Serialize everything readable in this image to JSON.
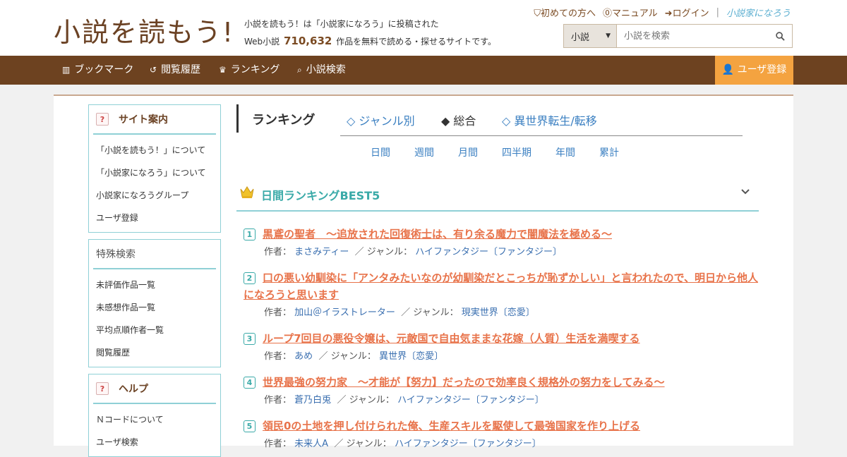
{
  "header": {
    "logo_text": "小説を読もう!",
    "description_line1": "小説を読もう！は「小説家になろう」に投稿された",
    "description_prefix": "Web小説",
    "work_count": "710,632",
    "description_suffix": "作品を無料で読める・探せるサイトです。",
    "top_links": [
      {
        "label": "初めての方へ",
        "icon": "shield-icon"
      },
      {
        "label": "マニュアル",
        "icon": "question-circle-icon"
      },
      {
        "label": "ログイン",
        "icon": "login-icon"
      }
    ],
    "brand_link": "小説家になろう",
    "search": {
      "select_value": "小説",
      "placeholder": "小説を検索"
    }
  },
  "nav": {
    "items": [
      {
        "label": "ブックマーク",
        "icon": "bookmark-icon"
      },
      {
        "label": "閲覧履歴",
        "icon": "history-icon"
      },
      {
        "label": "ランキング",
        "icon": "crown-icon"
      },
      {
        "label": "小説検索",
        "icon": "search-icon"
      }
    ],
    "register": "ユーザ登録"
  },
  "sidebar": {
    "site_info": {
      "title": "サイト案内",
      "items": [
        "「小説を読もう！」について",
        "「小説家になろう」について",
        "小説家になろうグループ",
        "ユーザ登録"
      ]
    },
    "special_search": {
      "title": "特殊検索",
      "items": [
        "未評価作品一覧",
        "未感想作品一覧",
        "平均点順作者一覧",
        "閲覧履歴"
      ]
    },
    "help": {
      "title": "ヘルプ",
      "items": [
        "Ｎコードについて",
        "ユーザ検索"
      ]
    }
  },
  "ranking": {
    "title": "ランキング",
    "tabs": [
      "◇ ジャンル別",
      "◆ 総合",
      "◇ 異世界転生/転移"
    ],
    "periods": [
      "日間",
      "週間",
      "月間",
      "四半期",
      "年間",
      "累計"
    ],
    "best_title": "日間ランキングBEST5",
    "author_label": "作者：",
    "genre_label": "／ ジャンル：",
    "entries": [
      {
        "rank": "1",
        "title": "黒鳶の聖者　～追放された回復術士は、有り余る魔力で闇魔法を極める～",
        "author": "まさみティー",
        "genre": "ハイファンタジー〔ファンタジー〕"
      },
      {
        "rank": "2",
        "title": "口の悪い幼馴染に「アンタみたいなのが幼馴染だとこっちが恥ずかしい」と言われたので、明日から他人になろうと思います",
        "author": "加山＠イラストレーター",
        "genre": "現実世界〔恋愛〕"
      },
      {
        "rank": "3",
        "title": "ループ7回目の悪役令嬢は、元敵国で自由気ままな花嫁（人質）生活を満喫する",
        "author": "あめ",
        "genre": "異世界〔恋愛〕"
      },
      {
        "rank": "4",
        "title": "世界最強の努力家　～才能が【努力】だったので効率良く規格外の努力をしてみる～",
        "author": "蒼乃白兎",
        "genre": "ハイファンタジー〔ファンタジー〕"
      },
      {
        "rank": "5",
        "title": "領民0の土地を押し付けられた俺、生産スキルを駆使して最強国家を作り上げる",
        "author": "未来人A",
        "genre": "ハイファンタジー〔ファンタジー〕"
      }
    ]
  }
}
